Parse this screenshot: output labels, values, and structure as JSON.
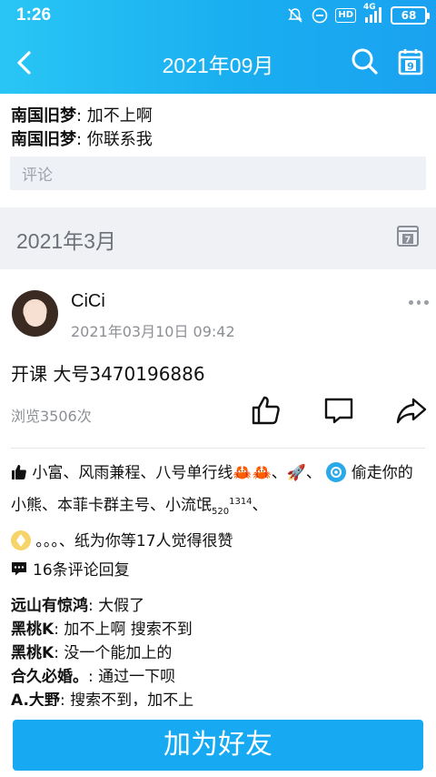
{
  "status_bar": {
    "time": "1:26",
    "hd": "HD",
    "network": "4G",
    "battery": "68"
  },
  "header": {
    "title": "2021年09月"
  },
  "prev_comments": [
    {
      "user": "南国旧梦",
      "text": ": 加不上啊"
    },
    {
      "user": "南国旧梦",
      "text": ": 你联系我"
    }
  ],
  "comment_input": {
    "placeholder": "评论"
  },
  "month_section": {
    "label": "2021年3月",
    "calendar_day": "7"
  },
  "post": {
    "author": "CiCi",
    "time": "2021年03月10日 09:42",
    "text": "开课 大号3470196886",
    "views": "浏览3506次"
  },
  "likes": {
    "seg1": "小富、风雨兼程、八号单行线",
    "seg2": "、",
    "seg3": "、",
    "seg4": " 偷走你的小熊、本菲卡群主号、小流氓",
    "sub": "520",
    "sup": "1314",
    "seg5": "、",
    "seg6": " 。。。、纸为你等17人觉得很赞"
  },
  "reply_summary": "16条评论回复",
  "replies": [
    {
      "user": "远山有惊鸿",
      "text": ": 大假了"
    },
    {
      "user": "黑桃K",
      "text": ": 加不上啊 搜索不到"
    },
    {
      "user": "黑桃K",
      "text": ": 没一个能加上的"
    },
    {
      "user": "合久必婚。",
      "text": ": 通过一下呗"
    },
    {
      "user": "A.大野",
      "text": ": 搜索不到，加不上"
    }
  ],
  "primary_button": {
    "label": "加为好友"
  },
  "colors": {
    "header": "#1aaef0",
    "button": "#17aaf2",
    "section_bg": "#f0f1f5"
  }
}
